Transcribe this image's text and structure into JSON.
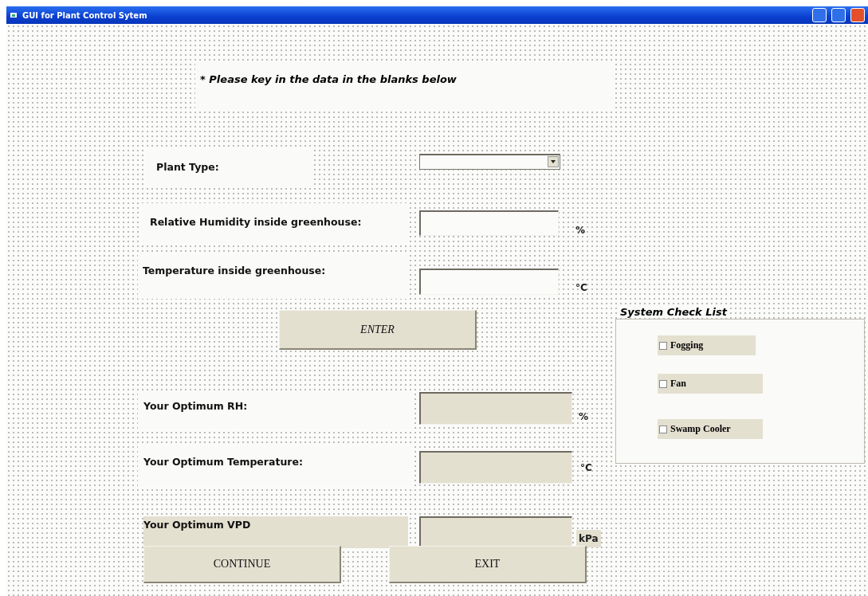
{
  "window": {
    "title": "GUI for Plant Control Sytem"
  },
  "instruction": "* Please key in the data in the blanks below",
  "inputs": [
    {
      "kind": "combo",
      "label": "Plant Type:"
    },
    {
      "kind": "text",
      "label": "Relative Humidity inside greenhouse:",
      "unit": "%"
    },
    {
      "kind": "text",
      "label": "Temperature inside greenhouse:",
      "unit": "°C"
    }
  ],
  "enter_button": "ENTER",
  "outputs": [
    {
      "label": "Your Optimum RH:",
      "unit": "%"
    },
    {
      "label": "Your Optimum Temperature:",
      "unit": "°C"
    },
    {
      "label": "Your Optimum VPD",
      "unit": "kPa"
    }
  ],
  "check_list": {
    "title": "System Check List",
    "items": [
      {
        "label": "Fogging",
        "checked": false
      },
      {
        "label": "Fan",
        "checked": false
      },
      {
        "label": "Swamp Cooler",
        "checked": false
      }
    ]
  },
  "buttons": [
    "CONTINUE",
    "EXIT"
  ]
}
